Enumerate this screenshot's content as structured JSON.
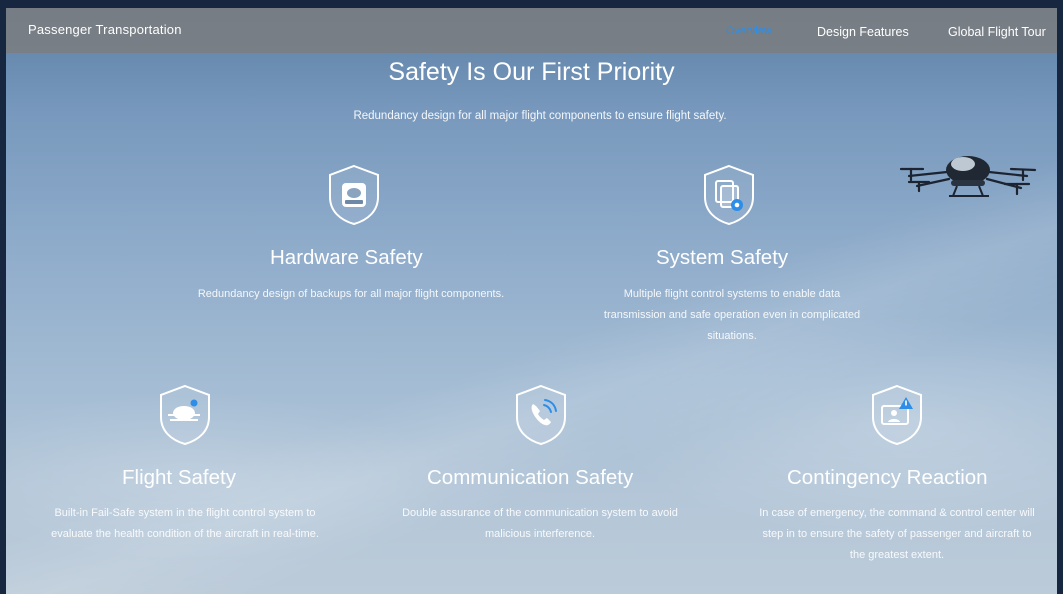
{
  "nav": {
    "brand": "Passenger Transportation",
    "links": [
      {
        "label": "Overview",
        "active": true
      },
      {
        "label": "Design Features",
        "active": false
      },
      {
        "label": "Global Flight Tour",
        "active": false
      }
    ]
  },
  "hero": {
    "title": "Safety Is Our First Priority",
    "subtitle": "Redundancy design for all major flight components to ensure flight safety."
  },
  "features": [
    {
      "icon": "hard-drive-icon",
      "title": "Hardware Safety",
      "desc": "Redundancy design of backups for all major flight components."
    },
    {
      "icon": "system-settings-icon",
      "title": "System Safety",
      "desc": "Multiple flight control systems to enable data transmission and safe operation even in complicated situations."
    },
    {
      "icon": "aircraft-icon",
      "title": "Flight Safety",
      "desc": "Built-in Fail-Safe system in the flight control system to evaluate the health condition of the aircraft in real-time."
    },
    {
      "icon": "phone-signal-icon",
      "title": "Communication Safety",
      "desc": "Double assurance of the communication system to avoid malicious interference."
    },
    {
      "icon": "command-center-alert-icon",
      "title": "Contingency Reaction",
      "desc": "In case of emergency, the command & control center will step in to ensure the safety of passenger and aircraft to the greatest extent."
    }
  ],
  "colors": {
    "accent": "#2e8de6",
    "navbar": "#7d7d7d",
    "text": "#ffffff"
  }
}
